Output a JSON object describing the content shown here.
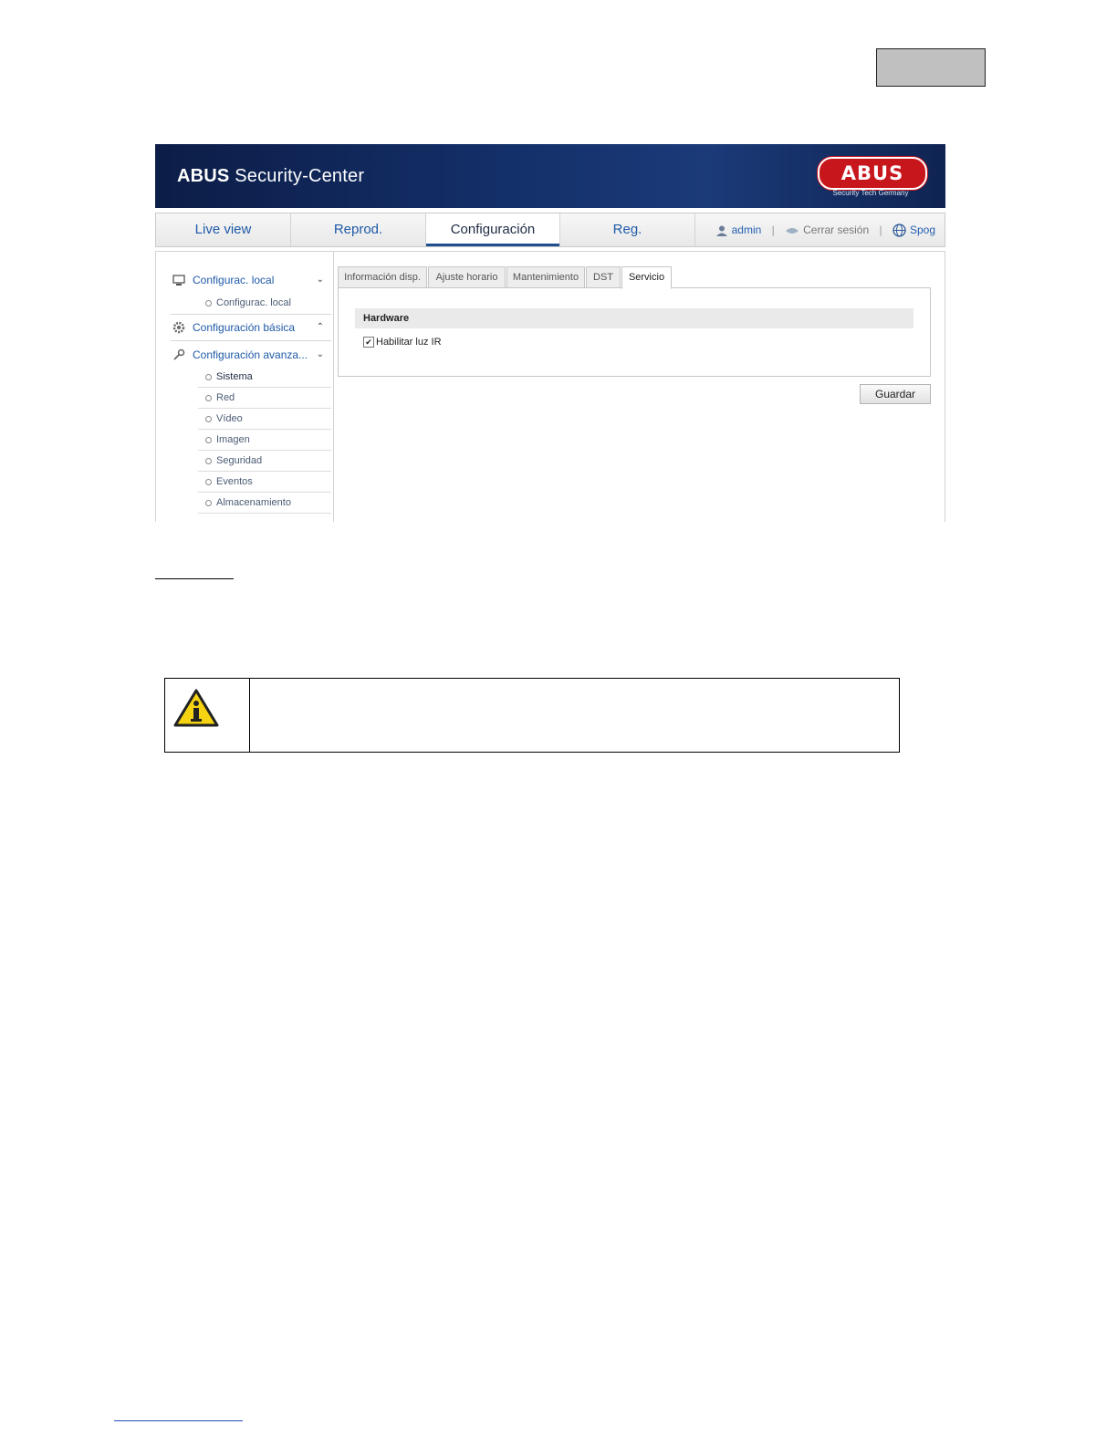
{
  "app": {
    "title_bold": "ABUS",
    "title_rest": " Security-Center",
    "logo_text": "ABUS",
    "logo_subtitle": "Security Tech Germany"
  },
  "nav": {
    "tabs": [
      {
        "label": "Live view",
        "active": false
      },
      {
        "label": "Reprod.",
        "active": false
      },
      {
        "label": "Configuración",
        "active": true
      },
      {
        "label": "Reg.",
        "active": false
      }
    ],
    "user": "admin",
    "logout": "Cerrar sesión",
    "language": "Spog"
  },
  "sidebar": {
    "local": {
      "label": "Configurac. local",
      "items": [
        "Configurac. local"
      ]
    },
    "basic": {
      "label": "Configuración básica"
    },
    "advanced": {
      "label": "Configuración avanza...",
      "items": [
        "Sistema",
        "Red",
        "Vídeo",
        "Imagen",
        "Seguridad",
        "Eventos",
        "Almacenamiento"
      ]
    }
  },
  "tabs": [
    "Información disp.",
    "Ajuste horario",
    "Mantenimiento",
    "DST",
    "Servicio"
  ],
  "active_tab": "Servicio",
  "panel": {
    "section": "Hardware",
    "checkbox_label": "Habilitar luz IR",
    "checkbox_checked": true
  },
  "save_label": "Guardar",
  "colors": {
    "banner": "#14306a",
    "logo": "#c8161d",
    "link": "#1f5aa8",
    "warning": "#f5d313"
  }
}
